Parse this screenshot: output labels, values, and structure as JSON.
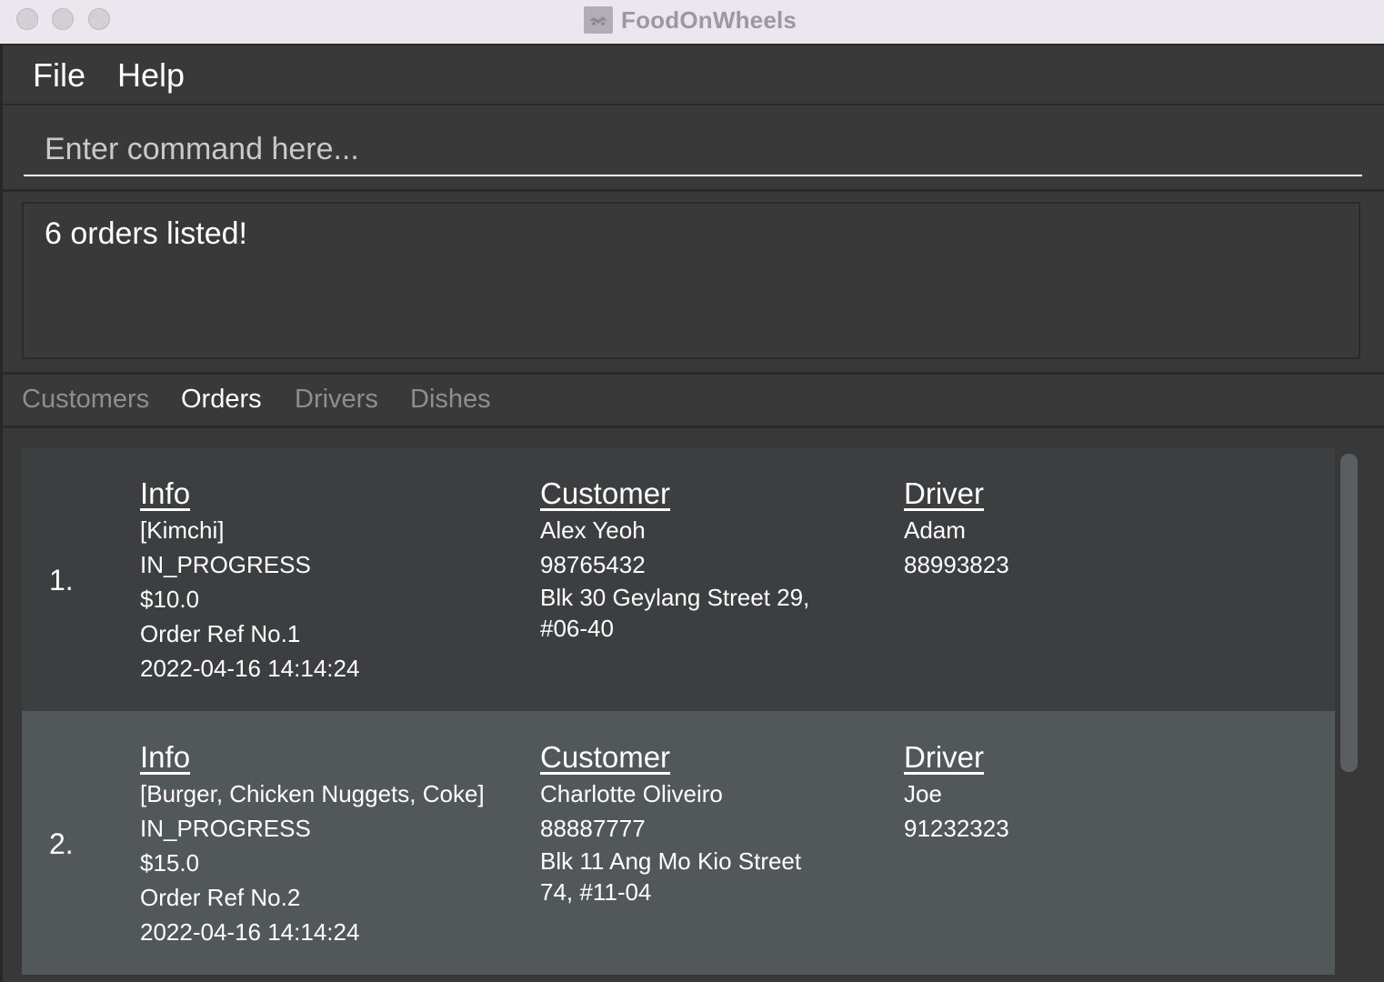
{
  "window": {
    "title": "FoodOnWheels"
  },
  "menu": {
    "file": "File",
    "help": "Help"
  },
  "command": {
    "placeholder": "Enter command here..."
  },
  "result": {
    "text": "6 orders listed!"
  },
  "tabs": [
    {
      "label": "Customers",
      "active": false
    },
    {
      "label": "Orders",
      "active": true
    },
    {
      "label": "Drivers",
      "active": false
    },
    {
      "label": "Dishes",
      "active": false
    }
  ],
  "orders": [
    {
      "index": "1.",
      "info_header": "Info",
      "dishes": "[Kimchi]",
      "status": "IN_PROGRESS",
      "price": "$10.0",
      "ref": "Order Ref No.1",
      "datetime": "2022-04-16 14:14:24",
      "customer_header": "Customer",
      "customer_name": "Alex Yeoh",
      "customer_phone": "98765432",
      "customer_address": "Blk 30 Geylang Street 29, #06-40",
      "driver_header": "Driver",
      "driver_name": "Adam",
      "driver_phone": "88993823"
    },
    {
      "index": "2.",
      "info_header": "Info",
      "dishes": "[Burger, Chicken Nuggets, Coke]",
      "status": "IN_PROGRESS",
      "price": "$15.0",
      "ref": "Order Ref No.2",
      "datetime": "2022-04-16 14:14:24",
      "customer_header": "Customer",
      "customer_name": "Charlotte Oliveiro",
      "customer_phone": "88887777",
      "customer_address": "Blk 11 Ang Mo Kio Street 74, #11-04",
      "driver_header": "Driver",
      "driver_name": "Joe",
      "driver_phone": "91232323"
    }
  ],
  "colors": {
    "background": "#383838",
    "card_odd": "#3c3e3f",
    "card_even": "#525759",
    "text": "#ffffff",
    "tab_inactive": "#8e8e8e"
  }
}
